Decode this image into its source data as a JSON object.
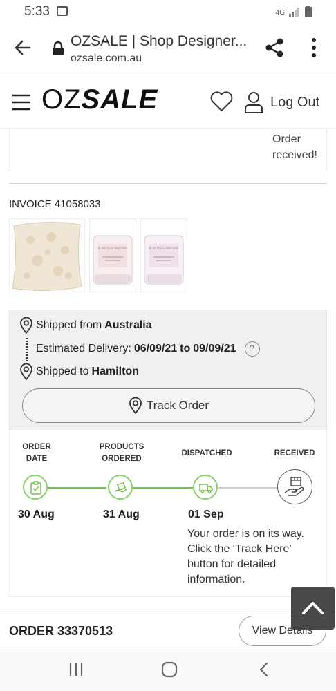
{
  "status_bar": {
    "time": "5:33",
    "network": "4G"
  },
  "browser": {
    "title": "OZSALE | Shop Designer...",
    "url": "ozsale.com.au"
  },
  "header": {
    "logo_left": "OZ",
    "logo_right": "SALE",
    "logout_label": "Log Out"
  },
  "previous_order": {
    "status_text": "Order received!"
  },
  "invoice": {
    "label": "INVOICE 41058033",
    "items": [
      {
        "name": "cushion-thumbnail"
      },
      {
        "name": "candle-thumbnail"
      },
      {
        "name": "candle-thumbnail"
      }
    ],
    "candle_brand": "PLANTES & PARFUMS"
  },
  "shipping": {
    "from_prefix": "Shipped from",
    "from_value": "Australia",
    "delivery_prefix": "Estimated Delivery:",
    "delivery_start": "06/09/21",
    "delivery_to": "to",
    "delivery_end": "09/09/21",
    "help_symbol": "?",
    "to_prefix": "Shipped to",
    "to_value": "Hamilton",
    "track_label": "Track Order"
  },
  "tracker": {
    "steps": [
      {
        "label_line1": "ORDER",
        "label_line2": "DATE",
        "date": "30 Aug",
        "done": true
      },
      {
        "label_line1": "PRODUCTS",
        "label_line2": "ORDERED",
        "date": "31 Aug",
        "done": true
      },
      {
        "label_line1": "DISPATCHED",
        "label_line2": "",
        "date": "01 Sep",
        "done": true
      },
      {
        "label_line1": "RECEIVED",
        "label_line2": "",
        "date": "",
        "done": false
      }
    ],
    "description": "Your order is on its way. Click the 'Track Here' button for detailed information."
  },
  "next_order": {
    "label": "ORDER 33370513",
    "view_details_label": "View Details"
  },
  "colors": {
    "progress_green": "#76c24b",
    "background_gray": "#f0f0f0",
    "text_dark": "#222222"
  }
}
